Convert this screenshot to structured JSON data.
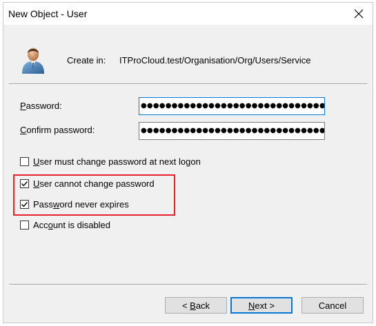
{
  "window": {
    "title": "New Object - User",
    "close_icon": "close-icon"
  },
  "header": {
    "icon": "user-icon",
    "create_in_label": "Create in:",
    "create_in_path": "ITProCloud.test/Organisation/Org/Users/Service"
  },
  "fields": {
    "password_label_key": "P",
    "password_label_rest": "assword:",
    "password_value": "●●●●●●●●●●●●●●●●●●●●●●●●●●●●●●●●●",
    "confirm_label_key": "C",
    "confirm_label_rest": "onfirm password:",
    "confirm_value": "●●●●●●●●●●●●●●●●●●●●●●●●●●●●●●●●●"
  },
  "options": [
    {
      "key": "U",
      "rest": "ser must change password at next logon",
      "checked": false
    },
    {
      "key": "U",
      "rest": "ser cannot change password",
      "checked": true
    },
    {
      "key_prefix": "Pass",
      "key": "w",
      "rest": "ord never expires",
      "checked": true
    },
    {
      "key_prefix": "Acc",
      "key": "o",
      "rest": "unt is disabled",
      "checked": false
    }
  ],
  "buttons": {
    "back_prefix": "< ",
    "back_key": "B",
    "back_rest": "ack",
    "next_key": "N",
    "next_rest": "ext >",
    "cancel": "Cancel"
  },
  "colors": {
    "highlight": "#e8222b",
    "focus_border": "#0078d7",
    "dialog_bg": "#f0f0f0"
  }
}
